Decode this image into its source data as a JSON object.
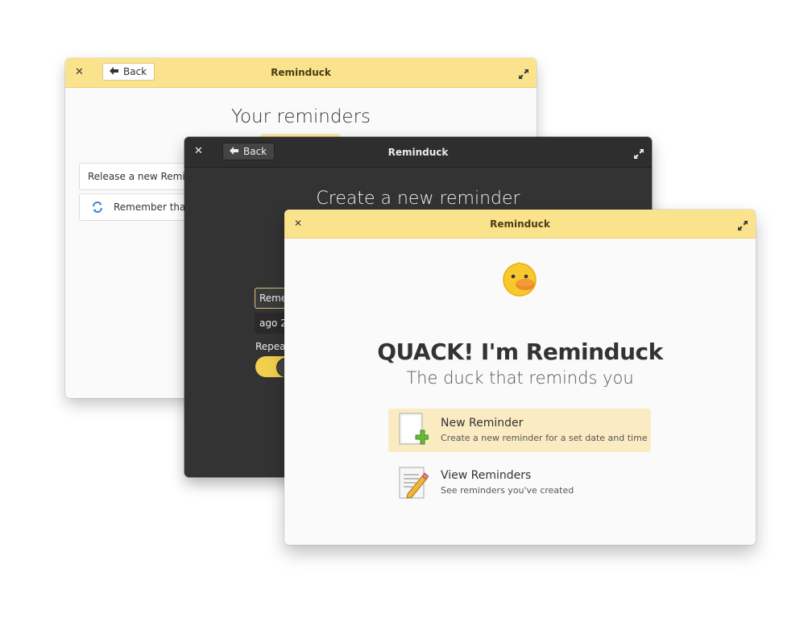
{
  "colors": {
    "accent": "#fbe38e",
    "dark_bg": "#333333",
    "light_bg": "#fafafa",
    "highlight": "#faebc3"
  },
  "window_back": {
    "title": "Reminduck",
    "close_icon": "✕",
    "back_label": "Back",
    "heading": "Your reminders",
    "reminders": [
      {
        "text": "Release a new Reminduck version",
        "icon": "none"
      },
      {
        "text": "Remember that Duck",
        "icon": "repeat-icon"
      }
    ]
  },
  "window_middle": {
    "title": "Reminduck",
    "close_icon": "✕",
    "back_label": "Back",
    "heading": "Create a new reminder",
    "description_value": "Remember",
    "date_value": "ago 24",
    "repeat_label": "Repeat",
    "repeat_toggle": "on"
  },
  "window_front": {
    "title": "Reminduck",
    "close_icon": "✕",
    "headline": "QUACK! I'm Reminduck",
    "subline": "The duck that reminds you",
    "actions": [
      {
        "label": "New Reminder",
        "description": "Create a new reminder for a set date and time",
        "icon": "new-document-icon"
      },
      {
        "label": "View Reminders",
        "description": "See reminders you've created",
        "icon": "edit-document-icon"
      }
    ]
  }
}
